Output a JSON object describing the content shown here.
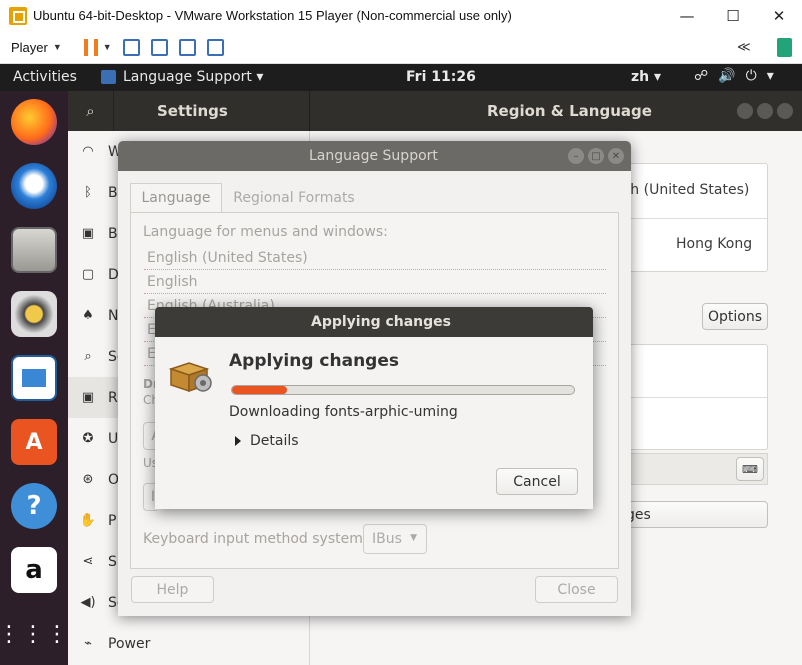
{
  "vm": {
    "title": "Ubuntu 64-bit-Desktop - VMware Workstation 15 Player (Non-commercial use only)",
    "player_label": "Player"
  },
  "topbar": {
    "activities": "Activities",
    "app_menu": "Language Support ▾",
    "clock": "Fri 11:26",
    "input_lang": "zh ▾"
  },
  "settings": {
    "title": "Settings",
    "panel_title": "Region & Language",
    "sidebar": [
      {
        "label": "W",
        "icon": "wifi-icon"
      },
      {
        "label": "B",
        "icon": "bluetooth-icon"
      },
      {
        "label": "B",
        "icon": "background-icon"
      },
      {
        "label": "D",
        "icon": "dock-icon"
      },
      {
        "label": "N",
        "icon": "notification-icon"
      },
      {
        "label": "Se",
        "icon": "search-icon"
      },
      {
        "label": "R",
        "icon": "region-icon"
      },
      {
        "label": "U",
        "icon": "universal-access-icon"
      },
      {
        "label": "O",
        "icon": "online-accounts-icon"
      },
      {
        "label": "P",
        "icon": "privacy-icon"
      },
      {
        "label": "Sh",
        "icon": "sharing-icon"
      },
      {
        "label": "So",
        "icon": "sound-icon"
      },
      {
        "label": "Power",
        "icon": "power-icon"
      }
    ],
    "language_value": "sh (United States)",
    "formats_value": "Hong Kong",
    "options_button": "Options",
    "manage_button": "ges"
  },
  "language_support": {
    "title": "Language Support",
    "tabs": [
      "Language",
      "Regional Formats"
    ],
    "menus_label": "Language for menus and windows:",
    "languages": [
      "English (United States)",
      "English",
      "English (Australia)",
      "E",
      "E"
    ],
    "drag_label": "Dr",
    "drag_sub": "Ch",
    "apply_btn": "A",
    "use_label": "Us",
    "install_btn": "I",
    "keyboard_label": "Keyboard input method system:",
    "keyboard_value": "IBus",
    "help_button": "Help",
    "close_button": "Close"
  },
  "applying": {
    "title": "Applying changes",
    "heading": "Applying changes",
    "progress": 0.16,
    "status": "Downloading fonts-arphic-uming",
    "details": "Details",
    "cancel": "Cancel"
  }
}
